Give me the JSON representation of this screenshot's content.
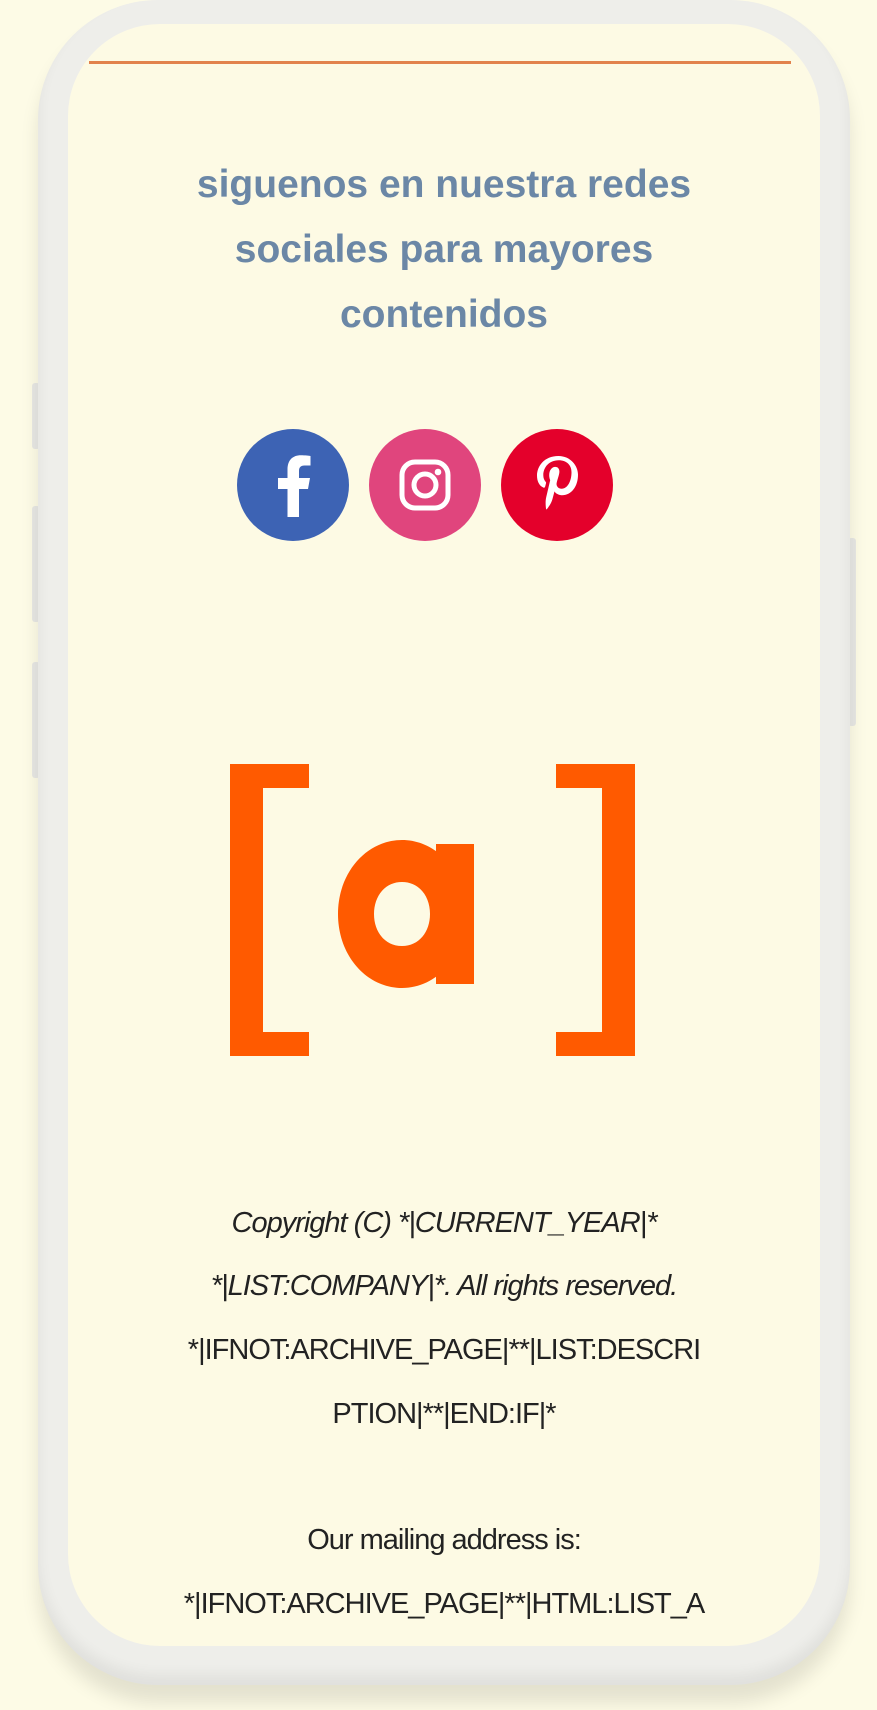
{
  "tagline": {
    "line1": "siguenos en nuestra redes",
    "line2": "sociales para mayores",
    "line3": "contenidos"
  },
  "social": [
    {
      "name": "facebook",
      "icon": "facebook-icon",
      "color": "#3d63b4"
    },
    {
      "name": "instagram",
      "icon": "instagram-icon",
      "color": "#e0457d"
    },
    {
      "name": "pinterest",
      "icon": "pinterest-icon",
      "color": "#e4002b"
    }
  ],
  "logo": {
    "text": "[a]",
    "color": "#ff5a00"
  },
  "footer": {
    "copyright_line1": "Copyright (C) *|CURRENT_YEAR|*",
    "copyright_line2": "*|LIST:COMPANY|*. All rights reserved.",
    "description_line1": "*|IFNOT:ARCHIVE_PAGE|**|LIST:DESCRI",
    "description_line2": "PTION|**|END:IF|*",
    "mailing_label": "Our mailing address is:",
    "mailing_value": "*|IFNOT:ARCHIVE_PAGE|**|HTML:LIST_A"
  }
}
